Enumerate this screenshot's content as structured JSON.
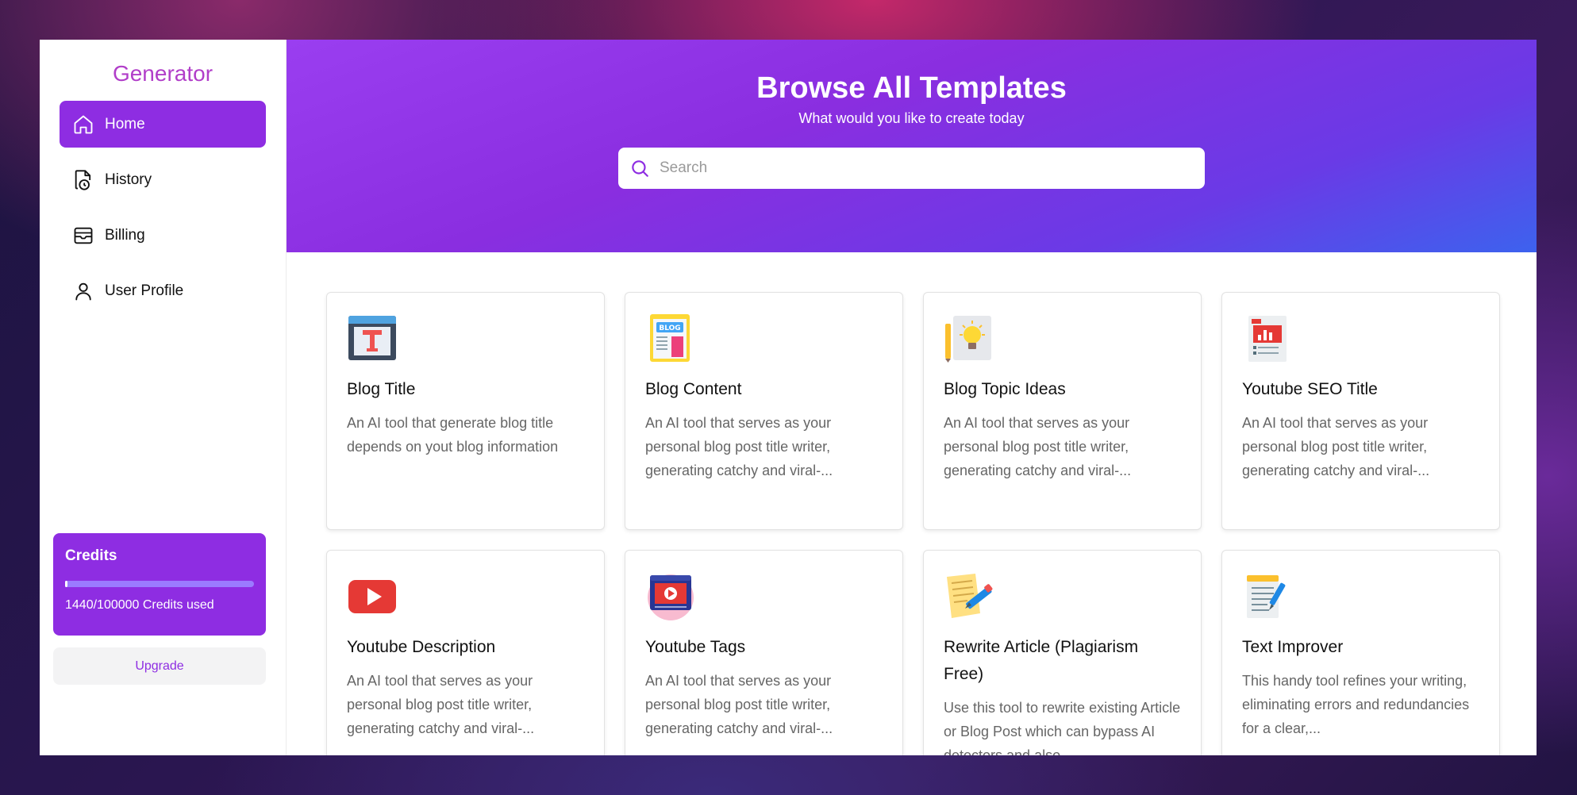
{
  "sidebar": {
    "brand": "Generator",
    "items": [
      {
        "label": "Home",
        "icon": "home-icon",
        "active": true
      },
      {
        "label": "History",
        "icon": "history-icon",
        "active": false
      },
      {
        "label": "Billing",
        "icon": "billing-icon",
        "active": false
      },
      {
        "label": "User Profile",
        "icon": "user-icon",
        "active": false
      }
    ],
    "credits": {
      "title": "Credits",
      "used_text": "1440/100000 Credits used",
      "used": 1440,
      "total": 100000
    },
    "upgrade_label": "Upgrade"
  },
  "hero": {
    "title": "Browse All Templates",
    "subtitle": "What would you like to create today",
    "search_placeholder": "Search"
  },
  "templates": [
    {
      "title": "Blog Title",
      "desc": "An AI tool that generate blog title depends on yout blog information",
      "icon": "blog-title-icon"
    },
    {
      "title": "Blog Content",
      "desc": "An AI tool that serves as your personal blog post title writer, generating catchy and viral-...",
      "icon": "blog-content-icon"
    },
    {
      "title": "Blog Topic Ideas",
      "desc": "An AI tool that serves as your personal blog post title writer, generating catchy and viral-...",
      "icon": "lightbulb-icon"
    },
    {
      "title": "Youtube SEO Title",
      "desc": "An AI tool that serves as your personal blog post title writer, generating catchy and viral-...",
      "icon": "seo-report-icon"
    },
    {
      "title": "Youtube Description",
      "desc": "An AI tool that serves as your personal blog post title writer, generating catchy and viral-...",
      "icon": "youtube-icon"
    },
    {
      "title": "Youtube Tags",
      "desc": "An AI tool that serves as your personal blog post title writer, generating catchy and viral-...",
      "icon": "video-player-icon"
    },
    {
      "title": "Rewrite Article (Plagiarism Free)",
      "desc": "Use this tool to rewrite existing Article or Blog Post which can bypass AI detectors and also...",
      "icon": "rewrite-icon"
    },
    {
      "title": "Text Improver",
      "desc": "This handy tool refines your writing, eliminating errors and redundancies for a clear,...",
      "icon": "notepad-icon"
    }
  ],
  "colors": {
    "accent": "#8e2de2",
    "brand": "#b13ec9",
    "progress_track": "#9b7bff"
  }
}
